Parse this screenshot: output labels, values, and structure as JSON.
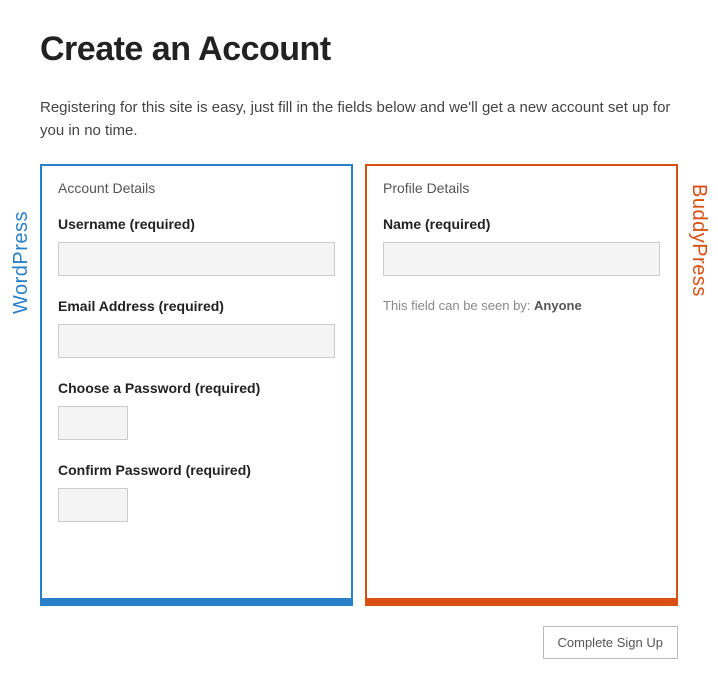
{
  "header": {
    "title": "Create an Account",
    "intro": "Registering for this site is easy, just fill in the fields below and we'll get a new account set up for you in no time."
  },
  "left_panel": {
    "side_label": "WordPress",
    "title": "Account Details",
    "fields": {
      "username_label": "Username (required)",
      "email_label": "Email Address (required)",
      "password_label": "Choose a Password (required)",
      "confirm_label": "Confirm Password (required)"
    }
  },
  "right_panel": {
    "side_label": "BuddyPress",
    "title": "Profile Details",
    "fields": {
      "name_label": "Name (required)"
    },
    "visibility_prefix": "This field can be seen by: ",
    "visibility_value": "Anyone"
  },
  "actions": {
    "submit_label": "Complete Sign Up"
  }
}
